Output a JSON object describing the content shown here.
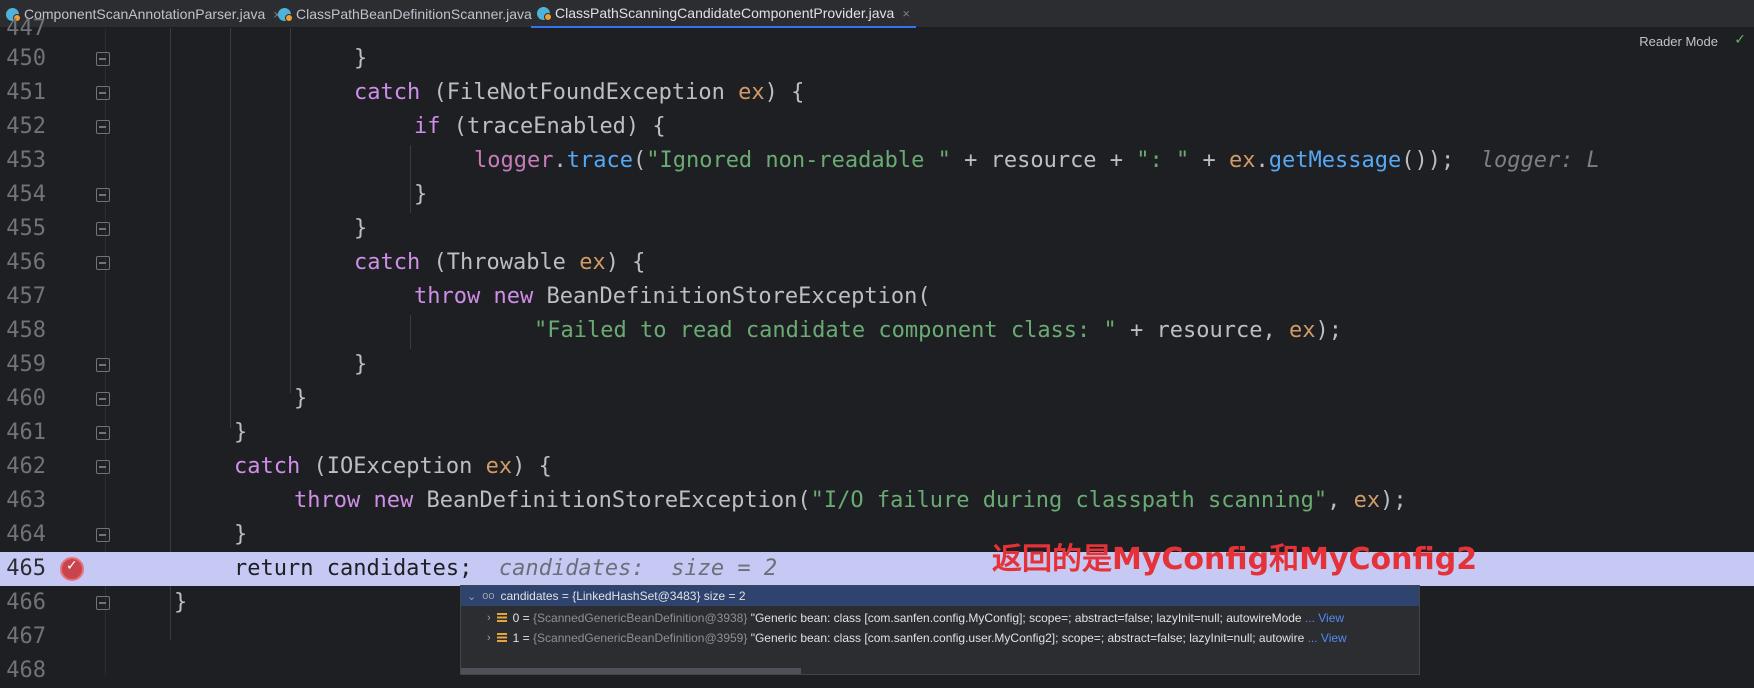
{
  "tabs": [
    {
      "label": "ComponentScanAnnotationParser.java",
      "active": false
    },
    {
      "label": "ClassPathBeanDefinitionScanner.java",
      "active": false
    },
    {
      "label": "ClassPathScanningCandidateComponentProvider.java",
      "active": true
    }
  ],
  "tab_close_glyph": "×",
  "reader_mode": "Reader Mode",
  "reader_check": "✓",
  "lines": [
    {
      "num": "447"
    },
    {
      "num": "450",
      "code": "}"
    },
    {
      "num": "451",
      "kw": "catch",
      "a": " (FileNotFoundException ",
      "b": "ex",
      "c": ") {"
    },
    {
      "num": "452",
      "kw": "if",
      "a": " (traceEnabled) {"
    },
    {
      "num": "453",
      "f1": "logger",
      "dot": ".",
      "f2": "trace",
      "a": "(",
      "s1": "\"Ignored non-readable \"",
      "b": " + resource + ",
      "s2": "\": \"",
      "c": " + ",
      "p": "ex",
      "d": ".",
      "f3": "getMessage",
      "e": "());",
      "hint": "logger: L"
    },
    {
      "num": "454",
      "code": "}"
    },
    {
      "num": "455",
      "code": "}"
    },
    {
      "num": "456",
      "kw": "catch",
      "a": " (Throwable ",
      "b": "ex",
      "c": ") {"
    },
    {
      "num": "457",
      "kw": "throw",
      "kw2": "new",
      "a": " BeanDefinitionStoreException("
    },
    {
      "num": "458",
      "s1": "\"Failed to read candidate component class: \"",
      "b": " + resource, ",
      "p": "ex",
      "c": ");"
    },
    {
      "num": "459",
      "code": "}"
    },
    {
      "num": "460",
      "code": "}"
    },
    {
      "num": "461",
      "code": "}"
    },
    {
      "num": "462",
      "kw": "catch",
      "a": " (IOException ",
      "b": "ex",
      "c": ") {"
    },
    {
      "num": "463",
      "kw": "throw",
      "kw2": "new",
      "a": " BeanDefinitionStoreException(",
      "s1": "\"I/O failure during classpath scanning\"",
      "b": ", ",
      "p": "ex",
      "c": ");"
    },
    {
      "num": "464",
      "code": "}"
    },
    {
      "num": "465",
      "code": "return candidates;",
      "hint": "candidates:  size = 2"
    },
    {
      "num": "466",
      "code": "}"
    },
    {
      "num": "467"
    },
    {
      "num": "468"
    }
  ],
  "annotation": "返回的是MyConfig和MyConfig2",
  "debug_popup": {
    "header": "candidates = {LinkedHashSet@3483}  size = 2",
    "items": [
      {
        "index": "0 = ",
        "ref": "{ScannedGenericBeanDefinition@3938}",
        "value": " \"Generic bean: class [com.sanfen.config.MyConfig]; scope=; abstract=false; lazyInit=null; autowireMode ",
        "view": "... View"
      },
      {
        "index": "1 = ",
        "ref": "{ScannedGenericBeanDefinition@3959}",
        "value": " \"Generic bean: class [com.sanfen.config.user.MyConfig2]; scope=; abstract=false; lazyInit=null; autowire ",
        "view": "... View"
      }
    ]
  }
}
